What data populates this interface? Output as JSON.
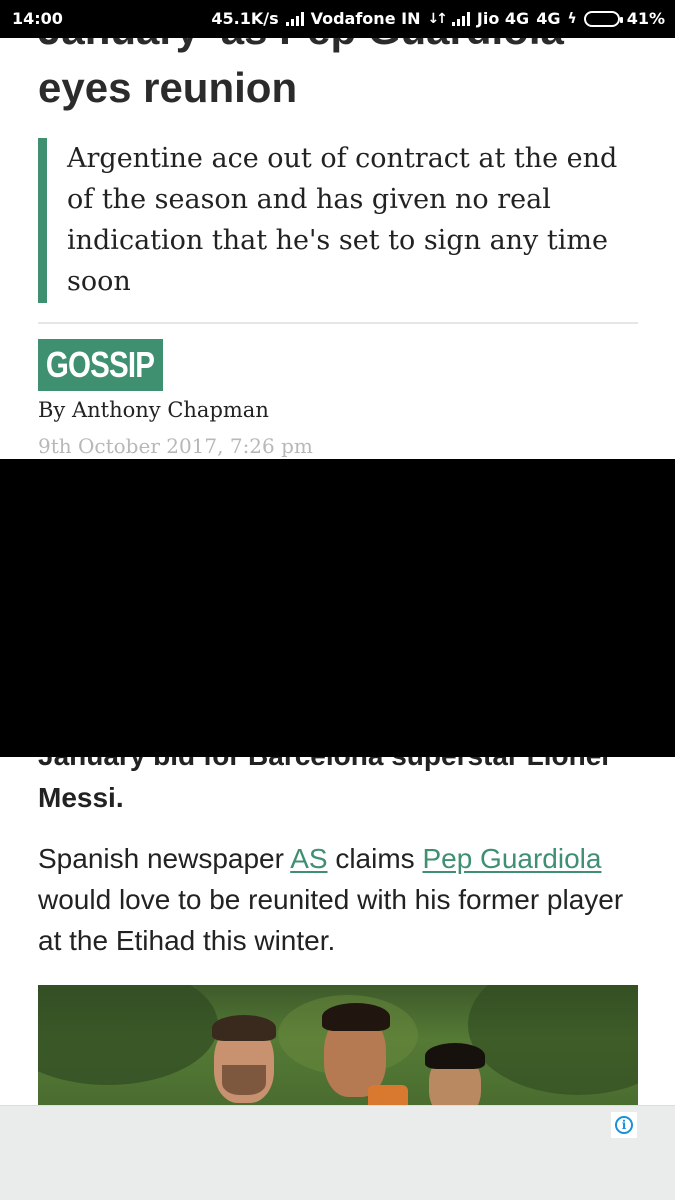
{
  "status_bar": {
    "time": "14:00",
    "net_speed": "45.1K/s",
    "carrier1": "Vodafone IN",
    "carrier2": "Jio 4G",
    "network_type": "4G",
    "battery": "41%"
  },
  "article": {
    "headline_clipped": "January' as Pep Guardiola",
    "headline_line2": "eyes reunion",
    "standfirst": "Argentine ace out of contract at the end of the season and has given no real indication that he's set to sign any time soon",
    "category": "GOSSIP",
    "byline": "By Anthony Chapman",
    "date": "9th October 2017, 7:26 pm",
    "lead_clipped": "January bid for Barcelona superstar Lionel",
    "lead_end": "Messi.",
    "para": {
      "text1": "Spanish newspaper ",
      "link1": "AS",
      "text2": " claims ",
      "link2": "Pep Guardiola",
      "text3": " would love to be reunited with his former player at the Etihad this winter."
    }
  },
  "colors": {
    "accent": "#3f9071",
    "ad_info": "#1a90d9"
  },
  "icons": {
    "signal": "signal-icon",
    "data": "data-arrows-icon",
    "charging": "bolt-icon",
    "battery": "battery-icon",
    "ad": "info-icon"
  }
}
